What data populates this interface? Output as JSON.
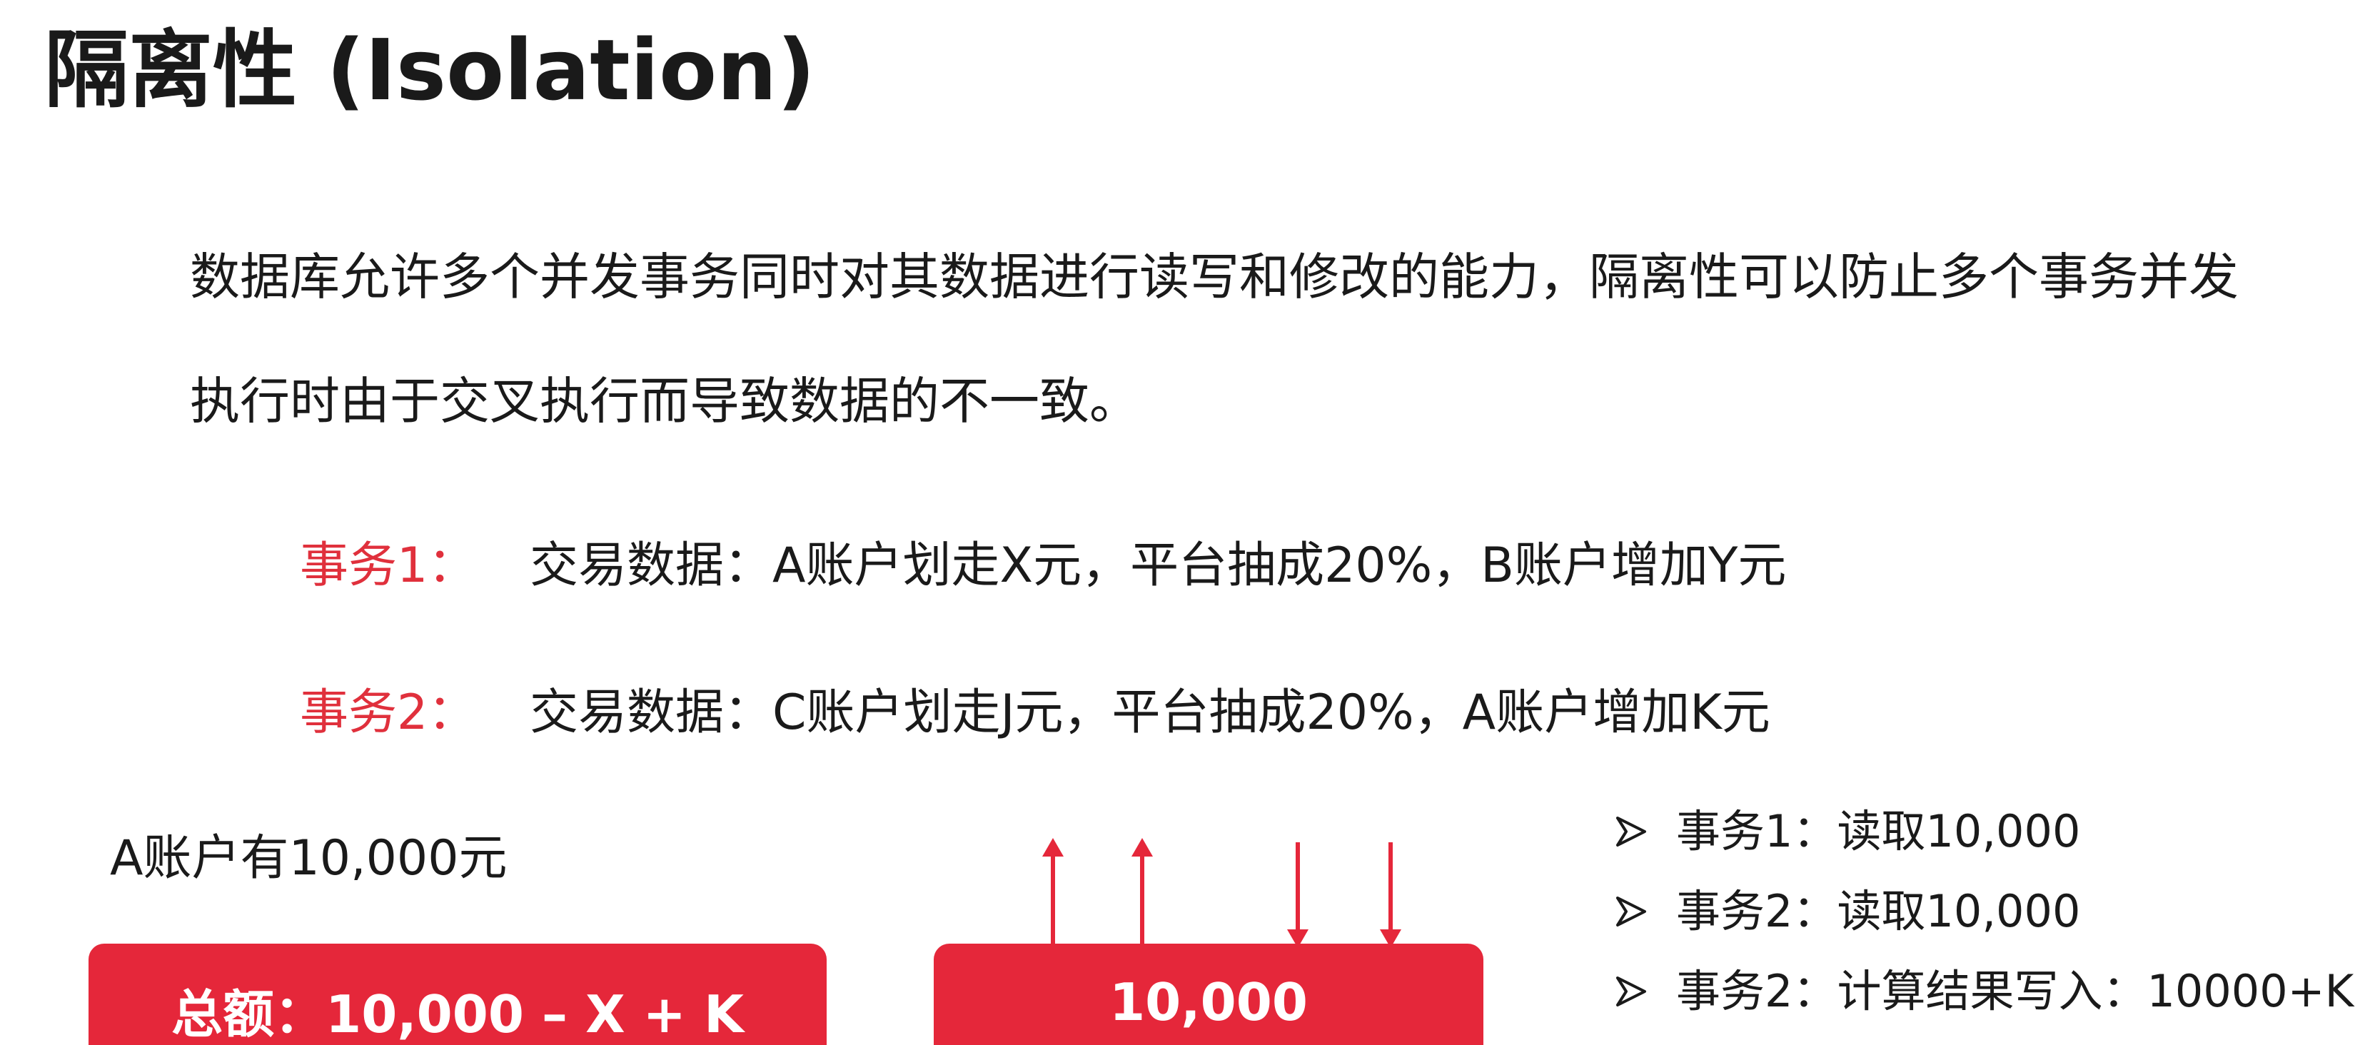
{
  "title": "隔离性 (Isolation)",
  "description": {
    "line1": "数据库允许多个并发事务同时对其数据进行读写和修改的能力，隔离性可以防止多个事务并发",
    "line2": "执行时由于交叉执行而导致数据的不一致。"
  },
  "transactions": [
    {
      "label": "事务1：",
      "text": "交易数据：A账户划走X元，平台抽成20%，B账户增加Y元"
    },
    {
      "label": "事务2：",
      "text": "交易数据：C账户划走J元，平台抽成20%，A账户增加K元"
    }
  ],
  "account_note": "A账户有10,000元",
  "total_box": "总额：10,000 – X + K",
  "balance_box": "10,000",
  "steps": [
    "事务1：读取10,000",
    "事务2：读取10,000",
    "事务2：计算结果写入：10000+K"
  ],
  "colors": {
    "accent_red": "#e5273a",
    "label_red": "#e0303c",
    "text": "#1a1a1a"
  },
  "icons": {
    "bullet": "arrowhead-bullet-icon",
    "arrow_up": "arrow-up-icon",
    "arrow_down": "arrow-down-icon"
  }
}
